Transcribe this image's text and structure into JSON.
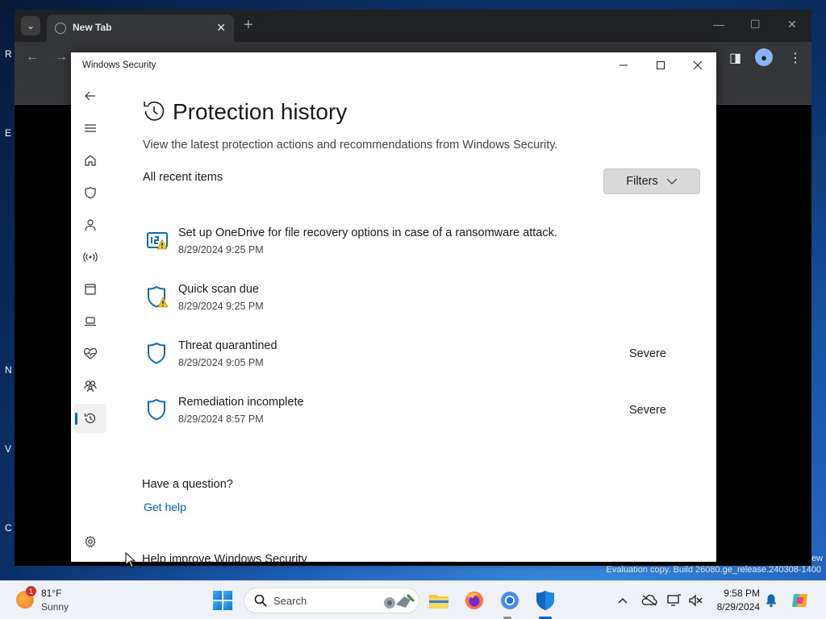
{
  "browser": {
    "tab_title": "New Tab"
  },
  "window": {
    "title": "Windows Security"
  },
  "page": {
    "title": "Protection history",
    "description": "View the latest protection actions and recommendations from Windows Security.",
    "section_label": "All recent items",
    "filters_label": "Filters"
  },
  "items": [
    {
      "title": "Set up OneDrive for file recovery options in case of a ransomware attack.",
      "date": "8/29/2024 9:25 PM",
      "severity": "",
      "icon": "onedrive-warning-icon"
    },
    {
      "title": "Quick scan due",
      "date": "8/29/2024 9:25 PM",
      "severity": "",
      "icon": "shield-warning-icon"
    },
    {
      "title": "Threat quarantined",
      "date": "8/29/2024 9:05 PM",
      "severity": "Severe",
      "icon": "shield-icon"
    },
    {
      "title": "Remediation incomplete",
      "date": "8/29/2024 8:57 PM",
      "severity": "Severe",
      "icon": "shield-icon"
    }
  ],
  "help": {
    "question": "Have a question?",
    "link": "Get help",
    "improve": "Help improve Windows Security"
  },
  "sidebar": {
    "items": [
      "back-icon",
      "menu-icon",
      "home-icon",
      "shield-icon",
      "account-icon",
      "firewall-icon",
      "app-browser-icon",
      "device-security-icon",
      "health-icon",
      "family-icon",
      "history-icon",
      "settings-icon"
    ],
    "active": "history-icon"
  },
  "taskbar": {
    "weather_temp": "81°F",
    "weather_cond": "Sunny",
    "weather_badge": "1",
    "search_placeholder": "Search",
    "time": "9:58 PM",
    "date": "8/29/2024"
  },
  "desktop": {
    "watermark": "Evaluation copy. Build 26080.ge_release.240308-1400",
    "watermark_partial": "ew"
  },
  "colors": {
    "accent": "#0067c0",
    "link": "#0060b8",
    "warning": "#f2c811",
    "shield": "#0a6fb5"
  }
}
